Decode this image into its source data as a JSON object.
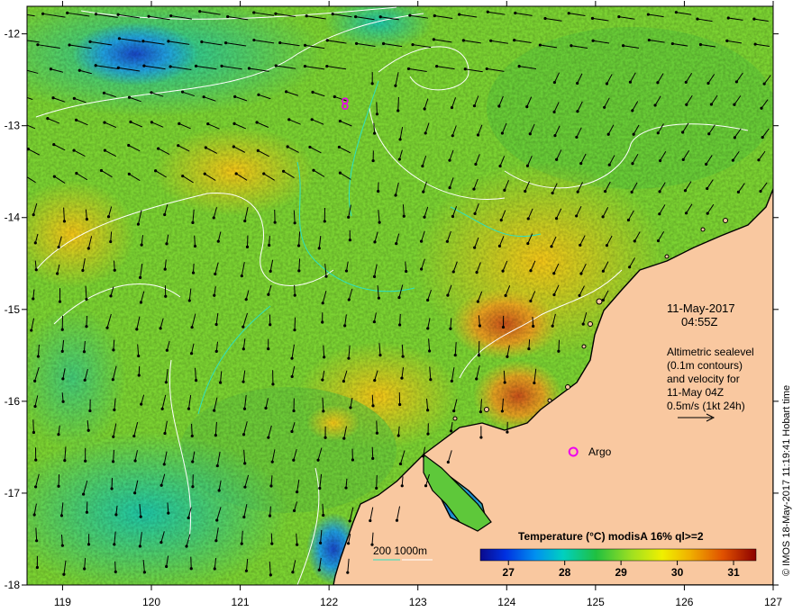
{
  "map": {
    "lon_range": [
      118.6,
      127.0
    ],
    "lat_range": [
      -18.0,
      -11.7
    ],
    "x_ticks": [
      119,
      120,
      121,
      122,
      123,
      124,
      125,
      126,
      127
    ],
    "y_ticks": [
      -12,
      -13,
      -14,
      -15,
      -16,
      -17,
      -18
    ]
  },
  "labels": {
    "date": "11-May-2017",
    "time": "04:55Z",
    "legend_lines": [
      "Altimetric sealevel",
      "(0.1m contours)",
      "and velocity for",
      "11-May 04Z",
      "0.5m/s (1kt 24h)"
    ],
    "argo": "Argo",
    "isobath": "200  1000m",
    "colorbar_title": "Temperature (°C) modisA 16% ql>=2",
    "credit": "© IMOS 18-May-2017 11:19:41 Hobart time"
  },
  "colorbar": {
    "range": [
      26.5,
      31.4
    ],
    "ticks": [
      27,
      28,
      29,
      30,
      31
    ]
  },
  "markers": {
    "argo": [
      {
        "lon": 124.75,
        "lat": -16.55
      }
    ],
    "small": [
      {
        "lon": 122.18,
        "lat": -12.73
      },
      {
        "lon": 122.18,
        "lat": -12.79
      }
    ]
  },
  "colors": {
    "land": "#f9c8a0",
    "coast": "#000000",
    "argo_marker": "#ee00ee",
    "contour": "#ffffff",
    "isobath_200": "#2ee0c0",
    "arrow": "#000000"
  }
}
